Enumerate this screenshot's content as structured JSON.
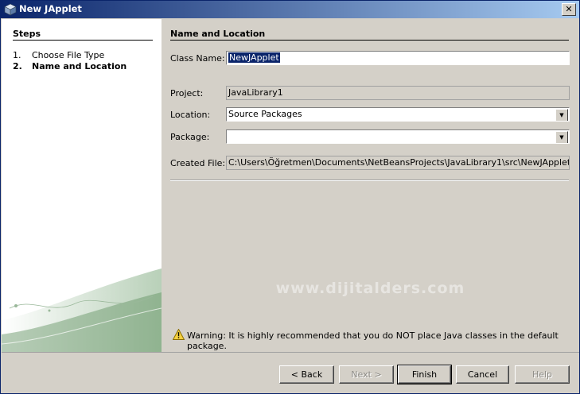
{
  "window": {
    "title": "New JApplet"
  },
  "steps": {
    "title": "Steps",
    "items": [
      {
        "num": "1.",
        "label": "Choose File Type",
        "current": false
      },
      {
        "num": "2.",
        "label": "Name and Location",
        "current": true
      }
    ]
  },
  "form": {
    "section_title": "Name and Location",
    "class_name": {
      "label": "Class Name:",
      "value": "NewJApplet"
    },
    "project": {
      "label": "Project:",
      "value": "JavaLibrary1"
    },
    "location": {
      "label": "Location:",
      "value": "Source Packages"
    },
    "package": {
      "label": "Package:",
      "value": ""
    },
    "created_file": {
      "label": "Created File:",
      "value": "C:\\Users\\Öğretmen\\Documents\\NetBeansProjects\\JavaLibrary1\\src\\NewJApplet.java"
    }
  },
  "watermark": "www.dijitalders.com",
  "warning": "Warning: It is highly recommended that you do NOT place Java classes in the default package.",
  "buttons": {
    "back": "< Back",
    "next": "Next >",
    "finish": "Finish",
    "cancel": "Cancel",
    "help": "Help"
  },
  "icons": {
    "app": "netbeans-cube-icon",
    "close": "close-icon",
    "warning": "warning-triangle-icon",
    "combo": "chevron-down-icon"
  },
  "colors": {
    "titlebar_start": "#0a246a",
    "titlebar_end": "#a6caf0",
    "dialog_bg": "#d4d0c8",
    "selection": "#0a246a"
  }
}
